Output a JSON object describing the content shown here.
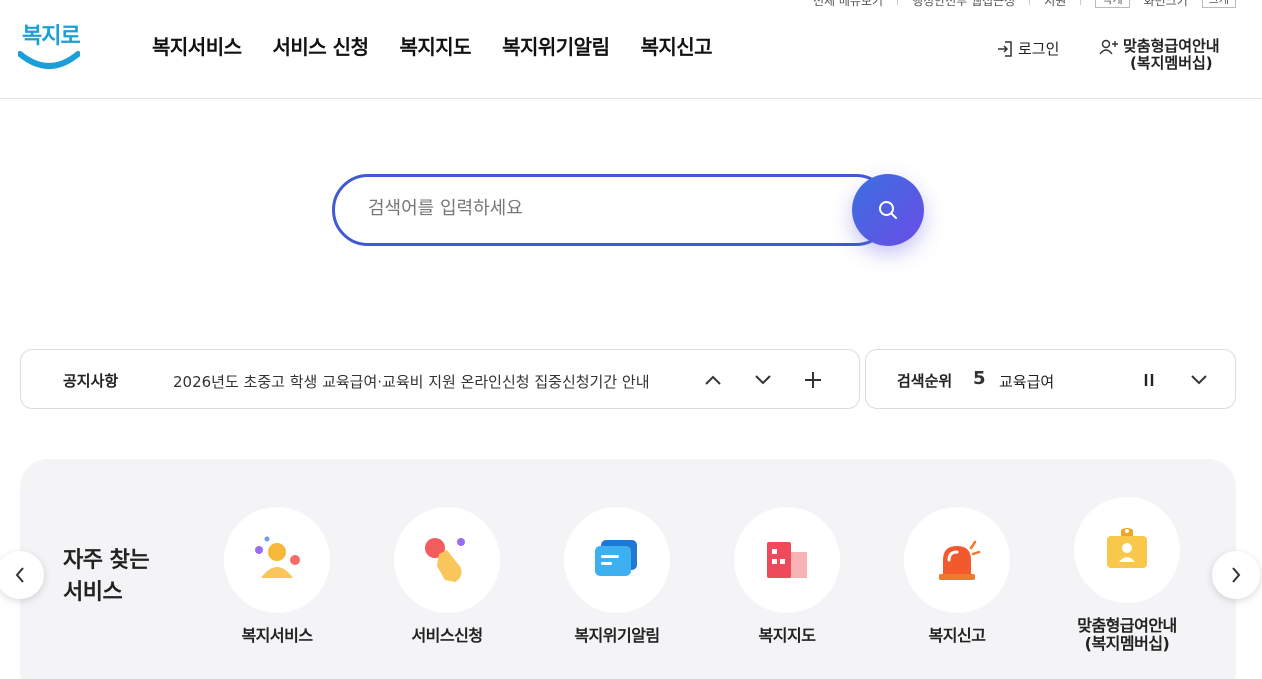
{
  "utility": {
    "links": [
      "전체 메뉴보기",
      "행정안전부 웹접근성",
      "지원"
    ],
    "font_small": "작게",
    "font_label": "화면크기",
    "font_large": "크게"
  },
  "header": {
    "logo_text": "복지로",
    "nav": [
      "복지서비스",
      "서비스 신청",
      "복지지도",
      "복지위기알림",
      "복지신고"
    ],
    "login": "로그인",
    "member_line1": "맞춤형급여안내",
    "member_line2": "(복지멤버십)"
  },
  "search": {
    "placeholder": "검색어를 입력하세요",
    "value": ""
  },
  "notice": {
    "title": "공지사항",
    "text": "2026년도 초중고 학생 교육급여·교육비 지원 온라인신청 집중신청기간 안내"
  },
  "rank": {
    "title": "검색순위",
    "number": "5",
    "keyword": "교육급여"
  },
  "services": {
    "heading_line1": "자주 찾는",
    "heading_line2": "서비스",
    "items": [
      {
        "label": "복지서비스",
        "icon": "person-icon"
      },
      {
        "label": "서비스신청",
        "icon": "hand-pointer-icon"
      },
      {
        "label": "복지위기알림",
        "icon": "message-icon"
      },
      {
        "label": "복지지도",
        "icon": "building-map-icon"
      },
      {
        "label": "복지신고",
        "icon": "siren-icon"
      },
      {
        "label": "맞춤형급여안내\n(복지멤버십)",
        "icon": "id-card-icon"
      }
    ]
  },
  "colors": {
    "accent": "#4159d3",
    "logo": "#1a9fd9",
    "panel": "#f4f4f6"
  }
}
